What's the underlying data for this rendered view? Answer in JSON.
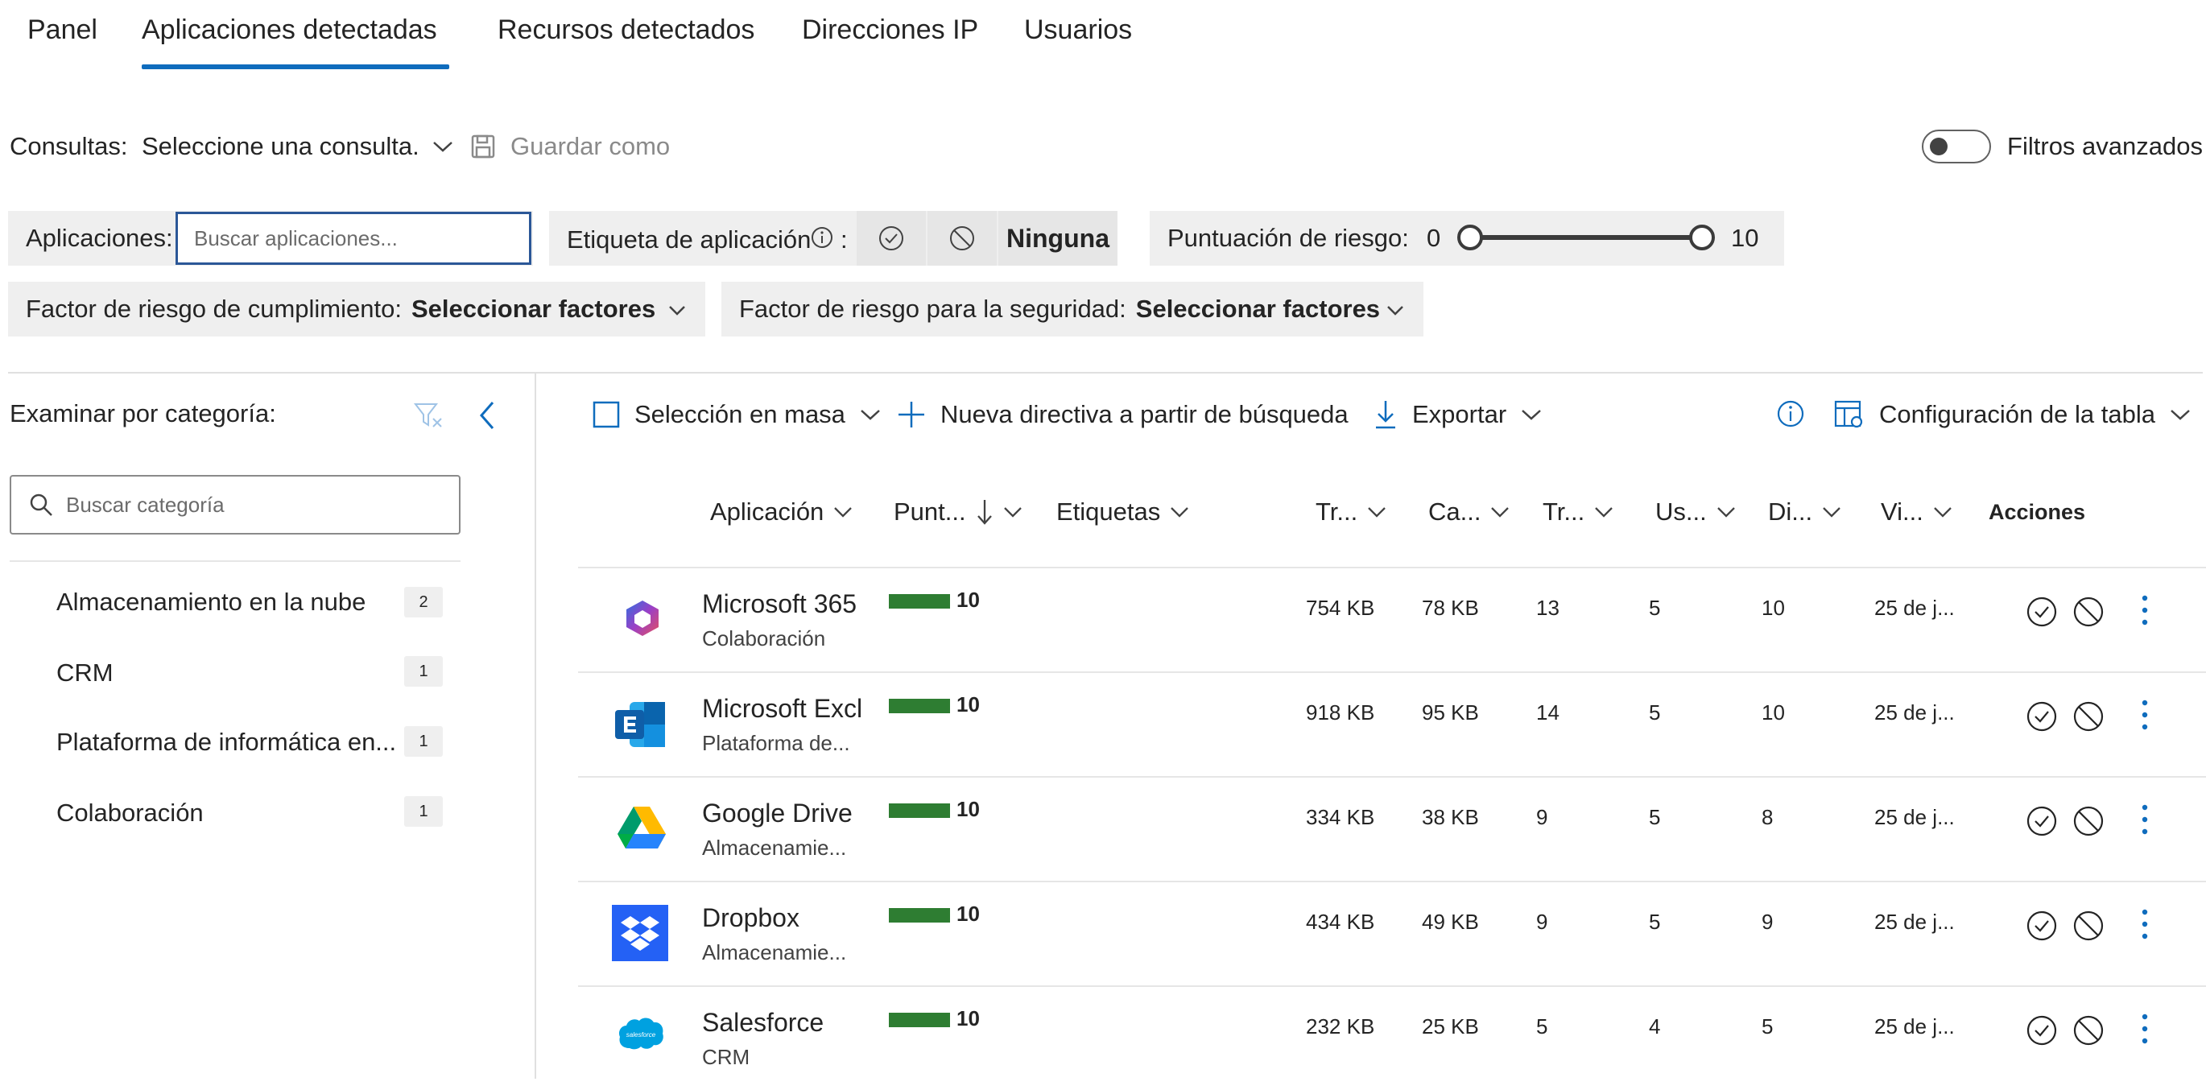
{
  "tabs": [
    {
      "label": "Panel"
    },
    {
      "label": "Aplicaciones detectadas",
      "active": true
    },
    {
      "label": "Recursos detectados"
    },
    {
      "label": "Direcciones IP"
    },
    {
      "label": "Usuarios"
    }
  ],
  "queries": {
    "label": "Consultas:",
    "select_value": "Seleccione una consulta.",
    "save_as": "Guardar como",
    "advanced_filters": "Filtros avanzados"
  },
  "filters": {
    "apps_label": "Aplicaciones:",
    "apps_placeholder": "Buscar aplicaciones...",
    "tag_label": "Etiqueta de aplicación",
    "tag_colon": ":",
    "tag_none": "Ninguna",
    "risk_label": "Puntuación de riesgo:",
    "risk_min": "0",
    "risk_max": "10",
    "compliance_label": "Factor de riesgo de cumplimiento:",
    "compliance_value": "Seleccionar factores",
    "security_label": "Factor de riesgo para la seguridad:",
    "security_value": "Seleccionar factores"
  },
  "categories": {
    "title": "Examinar por categoría:",
    "search_placeholder": "Buscar categoría",
    "items": [
      {
        "label": "Almacenamiento en la nube",
        "count": "2"
      },
      {
        "label": "CRM",
        "count": "1"
      },
      {
        "label": "Plataforma de informática en...",
        "count": "1"
      },
      {
        "label": "Colaboración",
        "count": "1"
      }
    ]
  },
  "toolbar": {
    "bulk": "Selección en masa",
    "new_policy": "Nueva directiva a partir de búsqueda",
    "export": "Exportar",
    "table_config": "Configuración de la tabla"
  },
  "columns": {
    "app": "Aplicación",
    "score": "Punt...",
    "tags": "Etiquetas",
    "traffic": "Tr...",
    "upload": "Ca...",
    "transactions": "Tr...",
    "users": "Us...",
    "ips": "Di...",
    "last_seen": "Vi...",
    "actions": "Acciones"
  },
  "rows": [
    {
      "name": "Microsoft 365",
      "category": "Colaboración",
      "score": "10",
      "traffic": "754 KB",
      "upload": "78 KB",
      "transactions": "13",
      "users": "5",
      "ips": "10",
      "last_seen": "25 de j...",
      "icon": "m365-icon"
    },
    {
      "name": "Microsoft Excl",
      "category": "Plataforma de...",
      "score": "10",
      "traffic": "918 KB",
      "upload": "95 KB",
      "transactions": "14",
      "users": "5",
      "ips": "10",
      "last_seen": "25 de j...",
      "icon": "exchange-icon"
    },
    {
      "name": "Google Drive",
      "category": "Almacenamie...",
      "score": "10",
      "traffic": "334 KB",
      "upload": "38 KB",
      "transactions": "9",
      "users": "5",
      "ips": "8",
      "last_seen": "25 de j...",
      "icon": "google-drive-icon"
    },
    {
      "name": "Dropbox",
      "category": "Almacenamie...",
      "score": "10",
      "traffic": "434 KB",
      "upload": "49 KB",
      "transactions": "9",
      "users": "5",
      "ips": "9",
      "last_seen": "25 de j...",
      "icon": "dropbox-icon"
    },
    {
      "name": "Salesforce",
      "category": "CRM",
      "score": "10",
      "traffic": "232 KB",
      "upload": "25 KB",
      "transactions": "5",
      "users": "4",
      "ips": "5",
      "last_seen": "25 de j...",
      "icon": "salesforce-icon",
      "icon_text": "salesforce"
    }
  ],
  "colors": {
    "accent": "#0f6cbd",
    "score_bar": "#2e7d32",
    "filter_bg": "#efefef"
  }
}
